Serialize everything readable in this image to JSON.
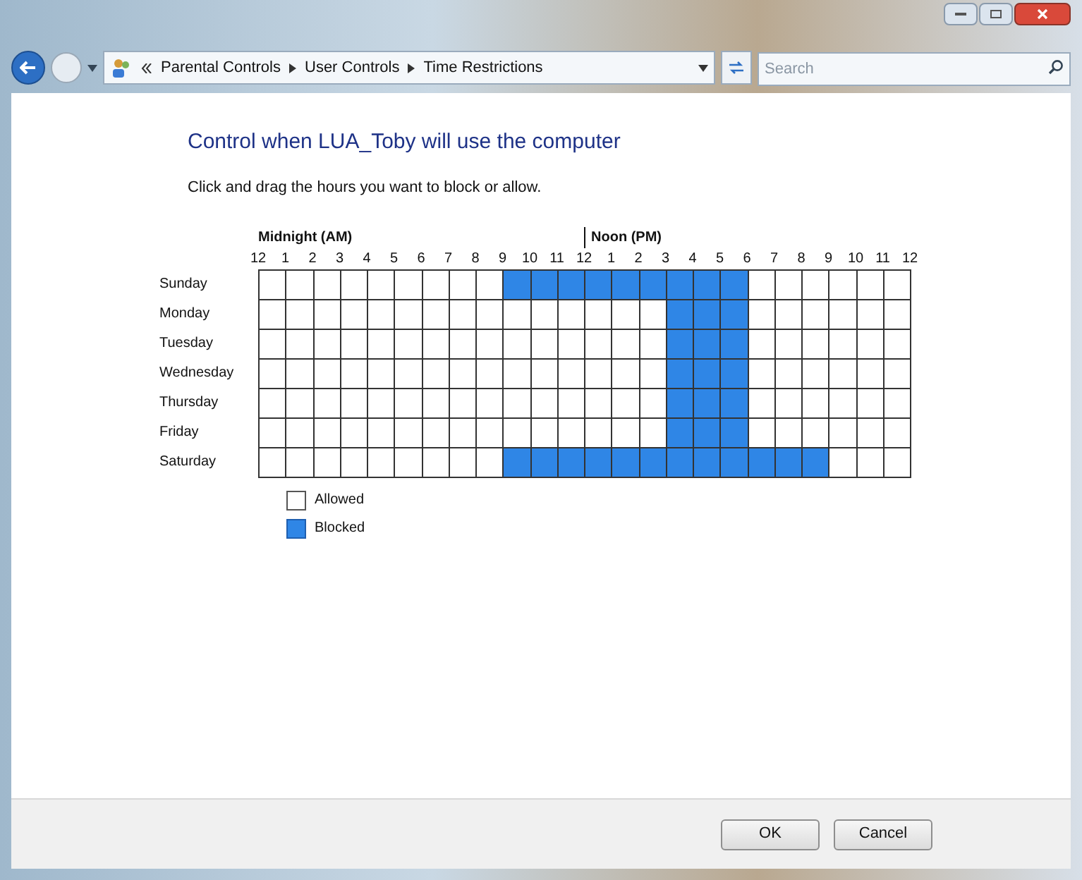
{
  "address_bar": {
    "breadcrumbs": [
      "Parental Controls",
      "User Controls",
      "Time Restrictions"
    ]
  },
  "search": {
    "placeholder": "Search"
  },
  "heading": "Control when LUA_Toby will use the computer",
  "instruction": "Click and drag the hours you want to block or allow.",
  "grid": {
    "am_label": "Midnight (AM)",
    "pm_label": "Noon (PM)",
    "hours": [
      "12",
      "1",
      "2",
      "3",
      "4",
      "5",
      "6",
      "7",
      "8",
      "9",
      "10",
      "11",
      "12",
      "1",
      "2",
      "3",
      "4",
      "5",
      "6",
      "7",
      "8",
      "9",
      "10",
      "11",
      "12"
    ],
    "days": [
      {
        "name": "Sunday",
        "blocked": [
          false,
          false,
          false,
          false,
          false,
          false,
          false,
          false,
          false,
          true,
          true,
          true,
          true,
          true,
          true,
          true,
          true,
          true,
          false,
          false,
          false,
          false,
          false,
          false
        ]
      },
      {
        "name": "Monday",
        "blocked": [
          false,
          false,
          false,
          false,
          false,
          false,
          false,
          false,
          false,
          false,
          false,
          false,
          false,
          false,
          false,
          true,
          true,
          true,
          false,
          false,
          false,
          false,
          false,
          false
        ]
      },
      {
        "name": "Tuesday",
        "blocked": [
          false,
          false,
          false,
          false,
          false,
          false,
          false,
          false,
          false,
          false,
          false,
          false,
          false,
          false,
          false,
          true,
          true,
          true,
          false,
          false,
          false,
          false,
          false,
          false
        ]
      },
      {
        "name": "Wednesday",
        "blocked": [
          false,
          false,
          false,
          false,
          false,
          false,
          false,
          false,
          false,
          false,
          false,
          false,
          false,
          false,
          false,
          true,
          true,
          true,
          false,
          false,
          false,
          false,
          false,
          false
        ]
      },
      {
        "name": "Thursday",
        "blocked": [
          false,
          false,
          false,
          false,
          false,
          false,
          false,
          false,
          false,
          false,
          false,
          false,
          false,
          false,
          false,
          true,
          true,
          true,
          false,
          false,
          false,
          false,
          false,
          false
        ]
      },
      {
        "name": "Friday",
        "blocked": [
          false,
          false,
          false,
          false,
          false,
          false,
          false,
          false,
          false,
          false,
          false,
          false,
          false,
          false,
          false,
          true,
          true,
          true,
          false,
          false,
          false,
          false,
          false,
          false
        ]
      },
      {
        "name": "Saturday",
        "blocked": [
          false,
          false,
          false,
          false,
          false,
          false,
          false,
          false,
          false,
          true,
          true,
          true,
          true,
          true,
          true,
          true,
          true,
          true,
          true,
          true,
          true,
          false,
          false,
          false
        ]
      }
    ]
  },
  "legend": [
    {
      "label": "Allowed",
      "kind": "allowed"
    },
    {
      "label": "Blocked",
      "kind": "blocked"
    }
  ],
  "buttons": [
    "OK",
    "Cancel"
  ]
}
